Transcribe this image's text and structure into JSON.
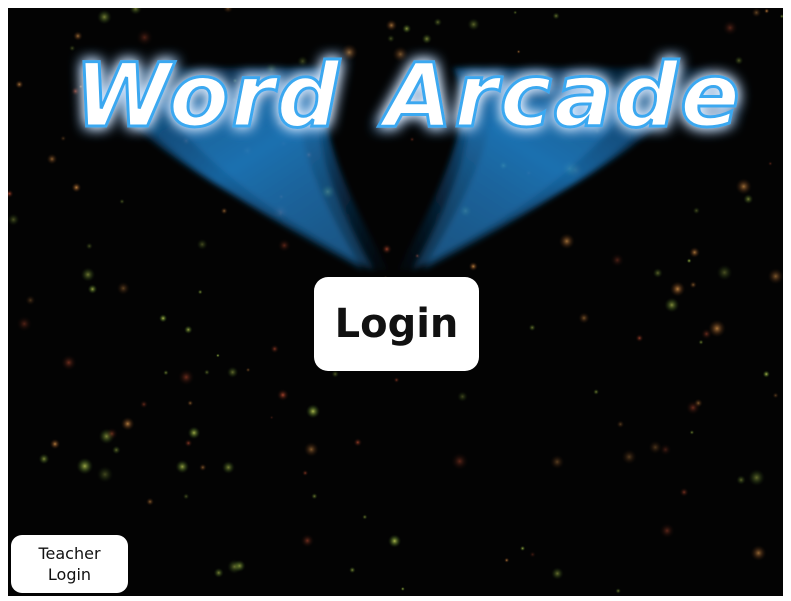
{
  "game": {
    "title_line_1": "Word",
    "title_line_2": "Arcade"
  },
  "buttons": {
    "login_label": "Login",
    "teacher_login_line_1": "Teacher",
    "teacher_login_line_2": "Login"
  },
  "colors": {
    "background": "#030303",
    "glow": "#1e8fd8",
    "button_fill": "#ffffff",
    "button_text": "#111111"
  }
}
